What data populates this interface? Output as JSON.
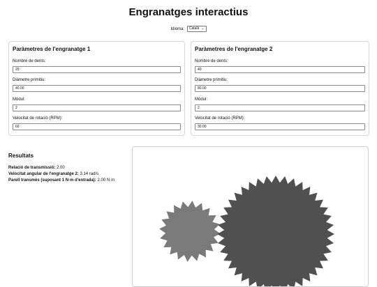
{
  "header": {
    "title": "Engranatges interactius",
    "language_label": "Idioma:",
    "language_value": "Català"
  },
  "gear1": {
    "heading": "Paràmetres de l'engranatge 1",
    "teeth_label": "Nombre de dents:",
    "teeth_value": "20",
    "diameter_label": "Diàmetre primitiu:",
    "diameter_value": "40.00",
    "module_label": "Mòdul:",
    "module_value": "2",
    "speed_label": "Velocitat de rotació (RPM):",
    "speed_value": "60"
  },
  "gear2": {
    "heading": "Paràmetres de l'engranatge 2",
    "teeth_label": "Nombre de dents:",
    "teeth_value": "40",
    "diameter_label": "Diàmetre primitiu:",
    "diameter_value": "80.00",
    "module_label": "Mòdul:",
    "module_value": "2",
    "speed_label": "Velocitat de rotació (RPM):",
    "speed_value": "30.00"
  },
  "results": {
    "heading": "Resultats",
    "ratio_label": "Relació de transmissió:",
    "ratio_value": "2.00",
    "angular_label": "Velocitat angular de l'engranatge 2:",
    "angular_value": "3.14 rad/s",
    "torque_label": "Parell transmès (suposant 1 N·m d'entrada):",
    "torque_value": "2.00 N·m"
  },
  "visual": {
    "gear1_color": "#7a7a7a",
    "gear2_color": "#505050"
  }
}
